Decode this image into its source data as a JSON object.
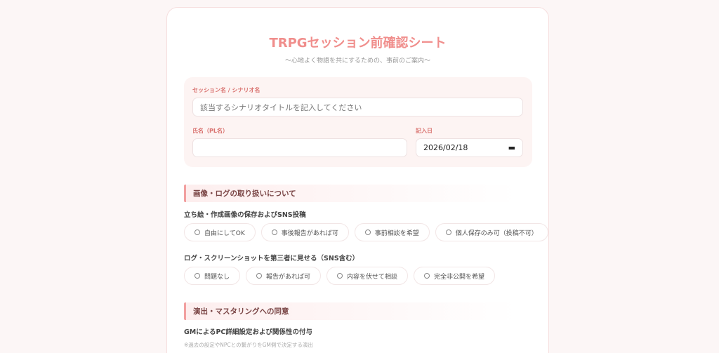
{
  "header": {
    "title": "TRPGセッション前確認シート",
    "subtitle": "～心地よく物語を共にするための、事前のご案内～"
  },
  "info": {
    "session_label": "セッション名 / シナリオ名",
    "session_placeholder": "該当するシナリオタイトルを記入してください",
    "name_label": "氏名（PL名）",
    "name_value": "",
    "date_label": "記入日",
    "date_value": "2026/02/18"
  },
  "sections": [
    {
      "title": "画像・ログの取り扱いについて",
      "questions": [
        {
          "label": "立ち絵・作成画像の保存およびSNS投稿",
          "options": [
            "自由にしてOK",
            "事後報告があれば可",
            "事前相談を希望",
            "個人保存のみ可（投稿不可）"
          ]
        },
        {
          "label": "ログ・スクリーンショットを第三者に見せる（SNS含む）",
          "options": [
            "問題なし",
            "報告があれば可",
            "内容を伏せて相談",
            "完全非公開を希望"
          ]
        }
      ]
    },
    {
      "title": "演出・マスタリングへの同意",
      "questions": [
        {
          "label": "GMによるPC詳細設定および関係性の付与",
          "note": "※過去の設定やNPCとの繋がりをGM側で決定する演出"
        }
      ]
    }
  ]
}
